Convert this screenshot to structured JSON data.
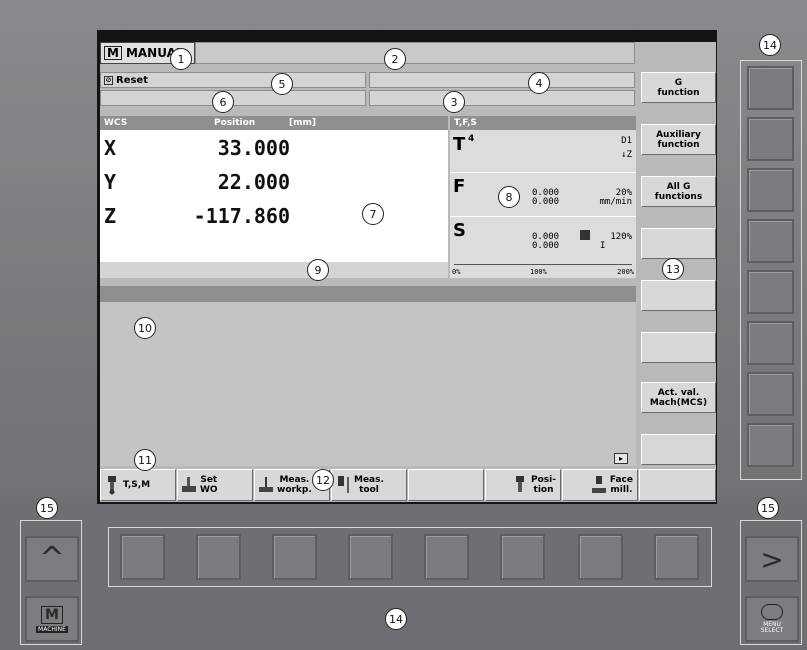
{
  "header": {
    "mode_title": "MANUAL",
    "reset_label": "Reset"
  },
  "position_panel": {
    "header_wcs": "WCS",
    "header_position": "Position",
    "header_unit": "[mm]",
    "axes": [
      {
        "name": "X",
        "value": "33.000"
      },
      {
        "name": "Y",
        "value": "22.000"
      },
      {
        "name": "Z",
        "value": "-117.860"
      }
    ]
  },
  "tfs_panel": {
    "header": "T,F,S",
    "tool_label": "T",
    "tool_number": "4",
    "tool_d": "D1",
    "tool_dir": "↓Z",
    "feed_label": "F",
    "feed_value1": "0.000",
    "feed_value2": "0.000",
    "feed_percent": "20%",
    "feed_unit": "mm/min",
    "spindle_label": "S",
    "spindle_value1": "0.000",
    "spindle_value2": "0.000",
    "spindle_percent": "120%",
    "spindle_gear": "I",
    "scale": [
      "0%",
      "100%",
      "200%"
    ]
  },
  "vertical_softkeys": [
    "G\nfunction",
    "Auxiliary\nfunction",
    "All G\nfunctions",
    "",
    "",
    "",
    "Act. val.\nMach(MCS)",
    ""
  ],
  "horizontal_softkeys": [
    {
      "label": "T,S,M",
      "icon": "tool-spindle-icon"
    },
    {
      "label": "Set\nWO",
      "icon": "set-wo-icon"
    },
    {
      "label": "Meas.\nworkp.",
      "icon": "measure-workpiece-icon"
    },
    {
      "label": "Meas.\ntool",
      "icon": "measure-tool-icon"
    },
    {
      "label": "",
      "icon": ""
    },
    {
      "label": "Posi-\ntion",
      "icon": "position-icon"
    },
    {
      "label": "Face\nmill.",
      "icon": "face-mill-icon"
    },
    {
      "label": "",
      "icon": ""
    }
  ],
  "hardware": {
    "machine_key_label": "MACHINE",
    "menu_select_label": "MENU\nSELECT",
    "recall_symbol": "^",
    "etc_symbol": ">"
  },
  "callouts": [
    "1",
    "2",
    "3",
    "4",
    "5",
    "6",
    "7",
    "8",
    "9",
    "10",
    "11",
    "12",
    "13",
    "14",
    "14",
    "15",
    "15"
  ],
  "colors": {
    "bezel": "#7b7d80",
    "screen_bg": "#b9b9bb",
    "panel_white": "#ffffff",
    "header_grey": "#8f8f91"
  }
}
